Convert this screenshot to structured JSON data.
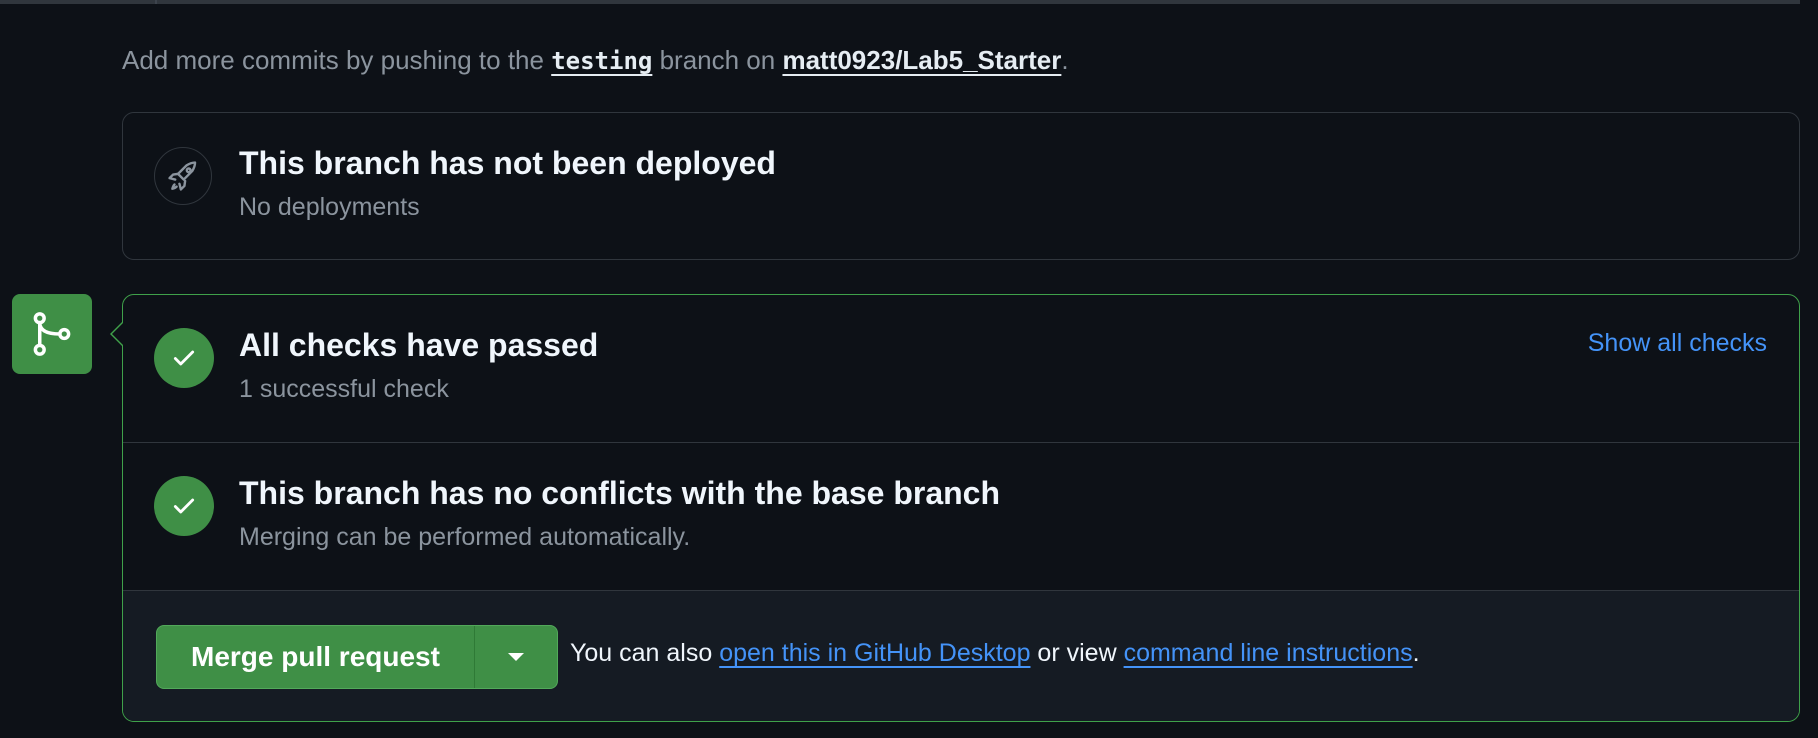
{
  "commit_hint": {
    "prefix": "Add more commits by pushing to the ",
    "branch": "testing",
    "middle": " branch on ",
    "repo": "matt0923/Lab5_Starter",
    "suffix": "."
  },
  "deployment": {
    "icon": "rocket-icon",
    "title": "This branch has not been deployed",
    "subtitle": "No deployments"
  },
  "merge_badge_icon": "git-merge-icon",
  "checks": {
    "icon": "check-icon",
    "title": "All checks have passed",
    "subtitle": "1 successful check",
    "show_all_label": "Show all checks"
  },
  "conflicts": {
    "icon": "check-icon",
    "title": "This branch has no conflicts with the base branch",
    "subtitle": "Merging can be performed automatically."
  },
  "merge": {
    "button_label": "Merge pull request",
    "dropdown_icon": "triangle-down-icon",
    "also_prefix": "You can also ",
    "desktop_link": "open this in GitHub Desktop",
    "also_middle": " or view ",
    "cli_link": "command line instructions",
    "also_suffix": "."
  },
  "colors": {
    "background": "#0d1117",
    "success": "#3f8f46",
    "link": "#4493f8",
    "muted": "#8b949e",
    "border": "#30363d"
  }
}
